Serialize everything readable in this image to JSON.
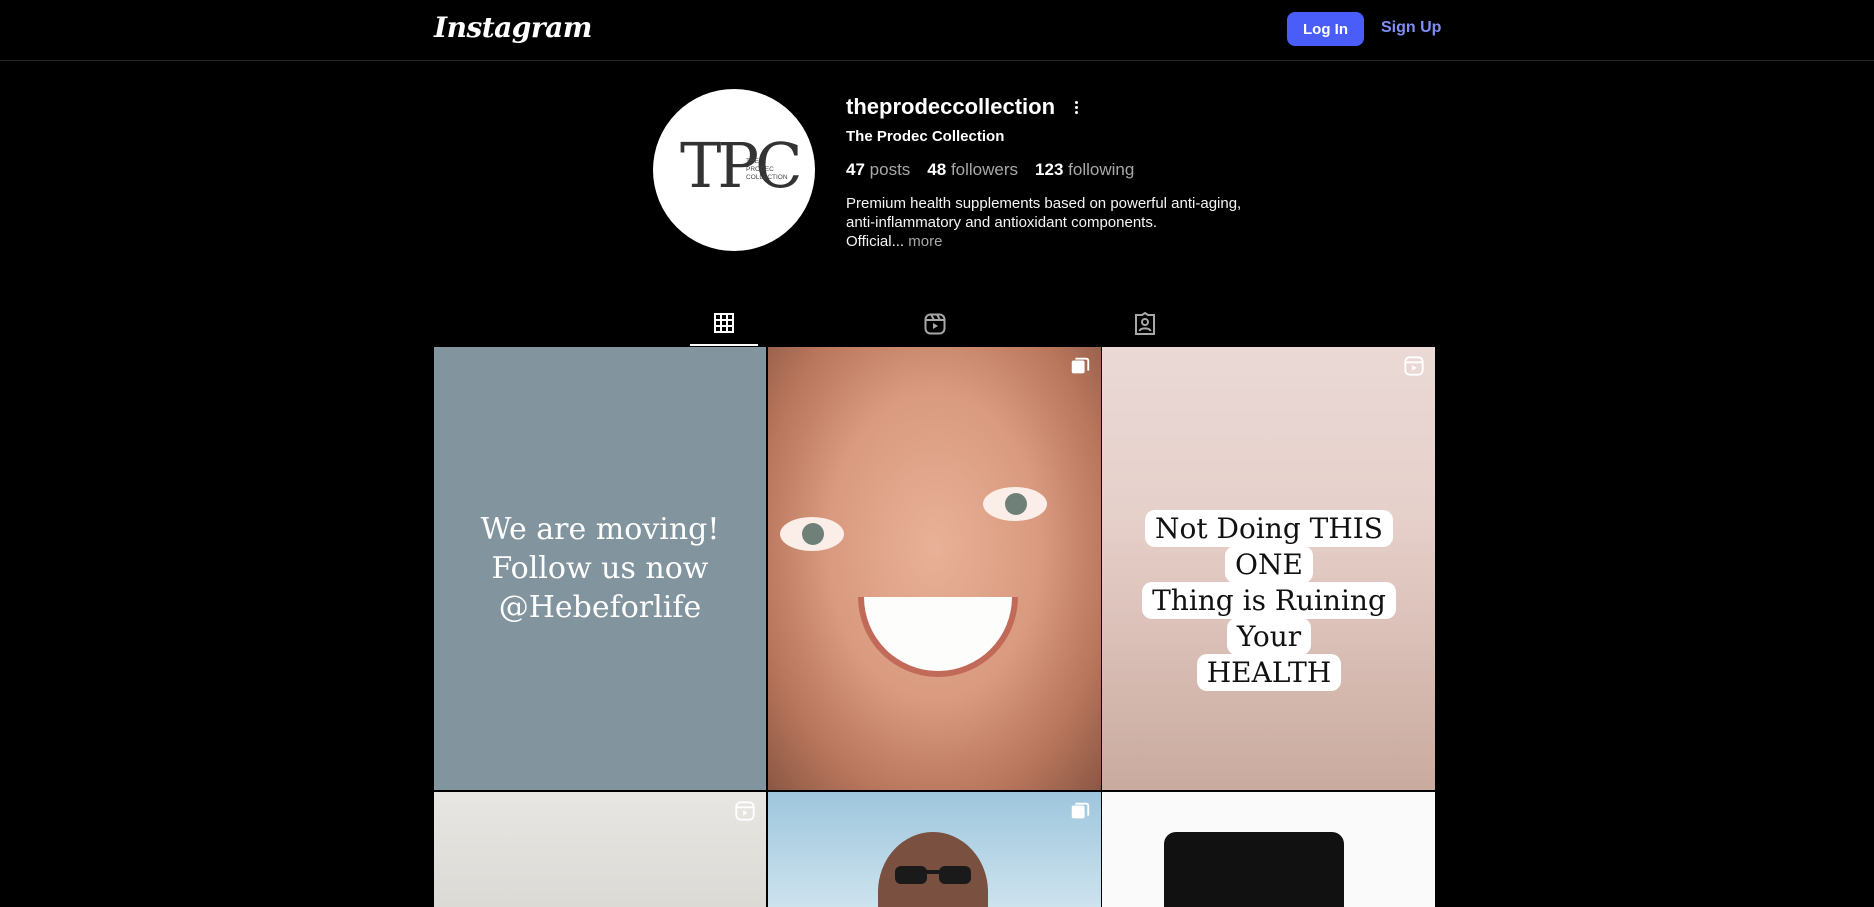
{
  "header": {
    "logo": "Instagram",
    "login_label": "Log In",
    "signup_label": "Sign Up"
  },
  "profile": {
    "username": "theprodeccollection",
    "full_name": "The Prodec Collection",
    "avatar_text": "TPC",
    "avatar_subtext": [
      "THE",
      "PRODEC",
      "COLLECTION"
    ],
    "stats": {
      "posts_count": "47",
      "posts_label": "posts",
      "followers_count": "48",
      "followers_label": "followers",
      "following_count": "123",
      "following_label": "following"
    },
    "bio_line1": "Premium health supplements based on powerful anti-aging,",
    "bio_line2": "anti-inflammatory and antioxidant components.",
    "bio_line3": "Official...",
    "bio_more": "more"
  },
  "tabs": [
    {
      "name": "posts",
      "icon": "grid-icon",
      "active": true
    },
    {
      "name": "reels",
      "icon": "reels-icon",
      "active": false
    },
    {
      "name": "tagged",
      "icon": "tagged-icon",
      "active": false
    }
  ],
  "posts": {
    "post1_text": [
      "We are moving!",
      "Follow us now",
      "@Hebeforlife"
    ],
    "post3_text": [
      "Not Doing THIS ONE",
      "Thing is Ruining Your",
      "HEALTH"
    ]
  },
  "colors": {
    "accent": "#4a5df9",
    "link": "#7f8ff7",
    "post1_bg": "#82949e"
  }
}
